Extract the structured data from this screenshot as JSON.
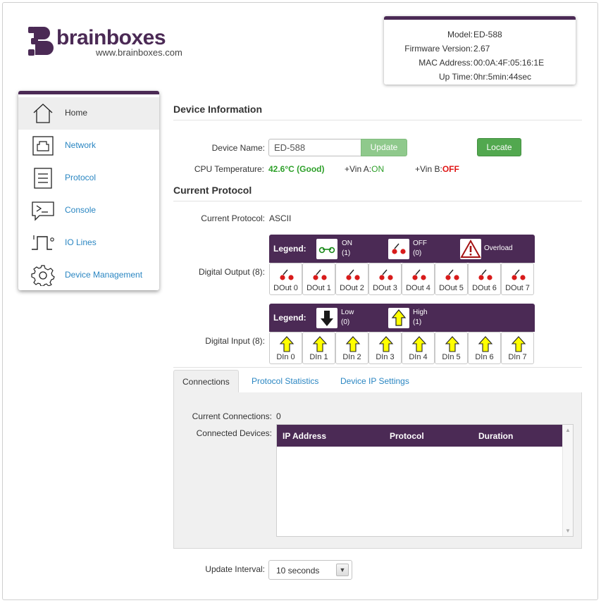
{
  "logo": {
    "word": "brainboxes",
    "url": "www.brainboxes.com"
  },
  "device_info": {
    "model_label": "Model:",
    "model": "ED-588",
    "firmware_label": "Firmware Version:",
    "firmware": "2.67",
    "mac_label": "MAC Address:",
    "mac": "00:0A:4F:05:16:1E",
    "uptime_label": "Up Time:",
    "uptime": "0hr:5min:44sec"
  },
  "sidebar": {
    "items": [
      {
        "label": "Home",
        "icon": "home-icon",
        "active": true
      },
      {
        "label": "Network",
        "icon": "network-port-icon"
      },
      {
        "label": "Protocol",
        "icon": "document-icon"
      },
      {
        "label": "Console",
        "icon": "console-icon"
      },
      {
        "label": "IO Lines",
        "icon": "pulse-icon"
      },
      {
        "label": "Device Management",
        "icon": "gear-icon"
      }
    ]
  },
  "device_information": {
    "heading": "Device Information",
    "device_name_label": "Device Name:",
    "device_name_value": "ED-588",
    "update_label": "Update",
    "locate_label": "Locate",
    "cpu_label": "CPU Temperature:",
    "cpu_value": "42.6°C (Good)",
    "vin_a_label": "+Vin A:",
    "vin_a_value": "ON",
    "vin_b_label": "+Vin B:",
    "vin_b_value": "OFF"
  },
  "current_protocol": {
    "heading": "Current Protocol",
    "protocol_label": "Current Protocol:",
    "protocol_value": "ASCII"
  },
  "digital_output": {
    "label": "Digital Output (8):",
    "legend_title": "Legend:",
    "legend": {
      "on_label": "ON",
      "on_value": "(1)",
      "off_label": "OFF",
      "off_value": "(0)",
      "overload_label": "Overload"
    },
    "lines": [
      "DOut 0",
      "DOut 1",
      "DOut 2",
      "DOut 3",
      "DOut 4",
      "DOut 5",
      "DOut 6",
      "DOut 7"
    ]
  },
  "digital_input": {
    "label": "Digital Input (8):",
    "legend_title": "Legend:",
    "legend": {
      "low_label": "Low",
      "low_value": "(0)",
      "high_label": "High",
      "high_value": "(1)"
    },
    "lines": [
      "DIn 0",
      "DIn 1",
      "DIn 2",
      "DIn 3",
      "DIn 4",
      "DIn 5",
      "DIn 6",
      "DIn 7"
    ]
  },
  "tabs": [
    {
      "label": "Connections",
      "active": true
    },
    {
      "label": "Protocol Statistics"
    },
    {
      "label": "Device IP Settings"
    }
  ],
  "connections": {
    "current_label": "Current Connections:",
    "current_value": "0",
    "devices_label": "Connected Devices:",
    "columns": [
      "IP Address",
      "Protocol",
      "Duration"
    ]
  },
  "update_interval": {
    "label": "Update Interval:",
    "value": "10 seconds"
  },
  "colors": {
    "brand_purple": "#4b2a55",
    "link_blue": "#2a86c2",
    "good_green": "#2ea02a",
    "off_red": "#e01515",
    "input_yellow": "#ffff00"
  }
}
